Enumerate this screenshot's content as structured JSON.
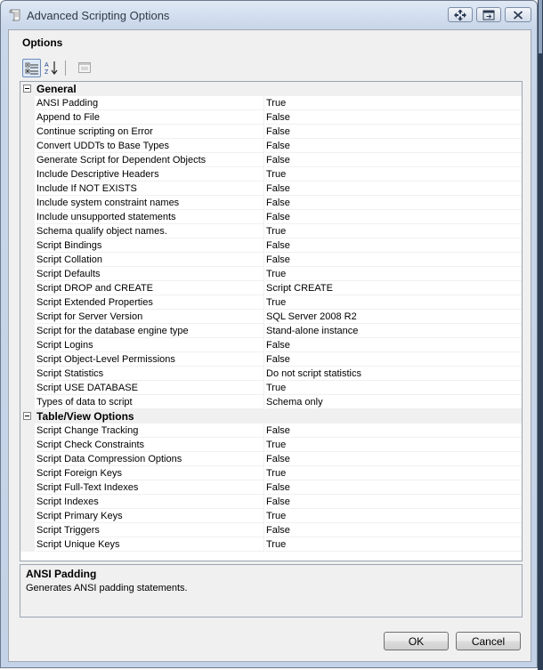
{
  "window": {
    "title": "Advanced Scripting Options"
  },
  "panel": {
    "options_label": "Options"
  },
  "toolbar": {
    "categorized_icon": "categorized-icon",
    "alphabetical_icon": "alphabetical-sort-icon",
    "property_pages_icon": "property-pages-icon"
  },
  "grid": {
    "categories": [
      {
        "name": "General",
        "rows": [
          {
            "name": "ANSI Padding",
            "value": "True"
          },
          {
            "name": "Append to File",
            "value": "False"
          },
          {
            "name": "Continue scripting on Error",
            "value": "False"
          },
          {
            "name": "Convert UDDTs to Base Types",
            "value": "False"
          },
          {
            "name": "Generate Script for Dependent Objects",
            "value": "False"
          },
          {
            "name": "Include Descriptive Headers",
            "value": "True"
          },
          {
            "name": "Include If NOT EXISTS",
            "value": "False"
          },
          {
            "name": "Include system constraint names",
            "value": "False"
          },
          {
            "name": "Include unsupported statements",
            "value": "False"
          },
          {
            "name": "Schema qualify object names.",
            "value": "True"
          },
          {
            "name": "Script Bindings",
            "value": "False"
          },
          {
            "name": "Script Collation",
            "value": "False"
          },
          {
            "name": "Script Defaults",
            "value": "True"
          },
          {
            "name": "Script DROP and CREATE",
            "value": "Script CREATE"
          },
          {
            "name": "Script Extended Properties",
            "value": "True"
          },
          {
            "name": "Script for Server Version",
            "value": "SQL Server 2008 R2"
          },
          {
            "name": "Script for the database engine type",
            "value": "Stand-alone instance"
          },
          {
            "name": "Script Logins",
            "value": "False"
          },
          {
            "name": "Script Object-Level Permissions",
            "value": "False"
          },
          {
            "name": "Script Statistics",
            "value": "Do not script statistics"
          },
          {
            "name": "Script USE DATABASE",
            "value": "True"
          },
          {
            "name": "Types of data to script",
            "value": "Schema only"
          }
        ]
      },
      {
        "name": "Table/View Options",
        "rows": [
          {
            "name": "Script Change Tracking",
            "value": "False"
          },
          {
            "name": "Script Check Constraints",
            "value": "True"
          },
          {
            "name": "Script Data Compression Options",
            "value": "False"
          },
          {
            "name": "Script Foreign Keys",
            "value": "True"
          },
          {
            "name": "Script Full-Text Indexes",
            "value": "False"
          },
          {
            "name": "Script Indexes",
            "value": "False"
          },
          {
            "name": "Script Primary Keys",
            "value": "True"
          },
          {
            "name": "Script Triggers",
            "value": "False"
          },
          {
            "name": "Script Unique Keys",
            "value": "True"
          }
        ]
      }
    ]
  },
  "description": {
    "title": "ANSI Padding",
    "text": "Generates ANSI padding statements."
  },
  "buttons": {
    "ok": "OK",
    "cancel": "Cancel"
  },
  "colors": {
    "window_frame": "#c9d7ea",
    "dialog_bg": "#f0f0f0",
    "grid_bg": "#ffffff"
  }
}
